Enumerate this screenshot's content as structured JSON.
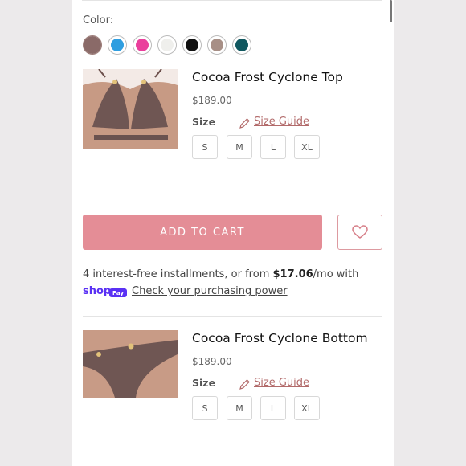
{
  "color_section": {
    "label": "Color:",
    "swatches": [
      {
        "name": "cocoa-frost",
        "color": "#8a6a68",
        "selected": true
      },
      {
        "name": "blue",
        "color": "#2f9ee0"
      },
      {
        "name": "pink",
        "color": "#ea3f9c"
      },
      {
        "name": "white",
        "color": "#efefec"
      },
      {
        "name": "black",
        "color": "#111111"
      },
      {
        "name": "taupe",
        "color": "#a78f86"
      },
      {
        "name": "teal",
        "color": "#10575f"
      }
    ]
  },
  "products": [
    {
      "title": "Cocoa Frost Cyclone Top",
      "price": "$189.00",
      "size_label": "Size",
      "size_guide": "Size Guide",
      "sizes": [
        "S",
        "M",
        "L",
        "XL"
      ]
    },
    {
      "title": "Cocoa Frost Cyclone Bottom",
      "price": "$189.00",
      "size_label": "Size",
      "size_guide": "Size Guide",
      "sizes": [
        "S",
        "M",
        "L",
        "XL"
      ]
    }
  ],
  "cart": {
    "add_label": "ADD TO CART",
    "wishlist_icon": "heart-icon"
  },
  "payment": {
    "installments_prefix": "4 interest-free installments, or from ",
    "installments_amount": "$17.06",
    "installments_suffix": "/mo with",
    "shop_logo": "shop",
    "pay_badge": "Pay",
    "check_link": "Check your purchasing power"
  },
  "colors": {
    "accent": "#e48d96",
    "size_guide": "#b26a6a",
    "shop_pay": "#5a31f4"
  }
}
